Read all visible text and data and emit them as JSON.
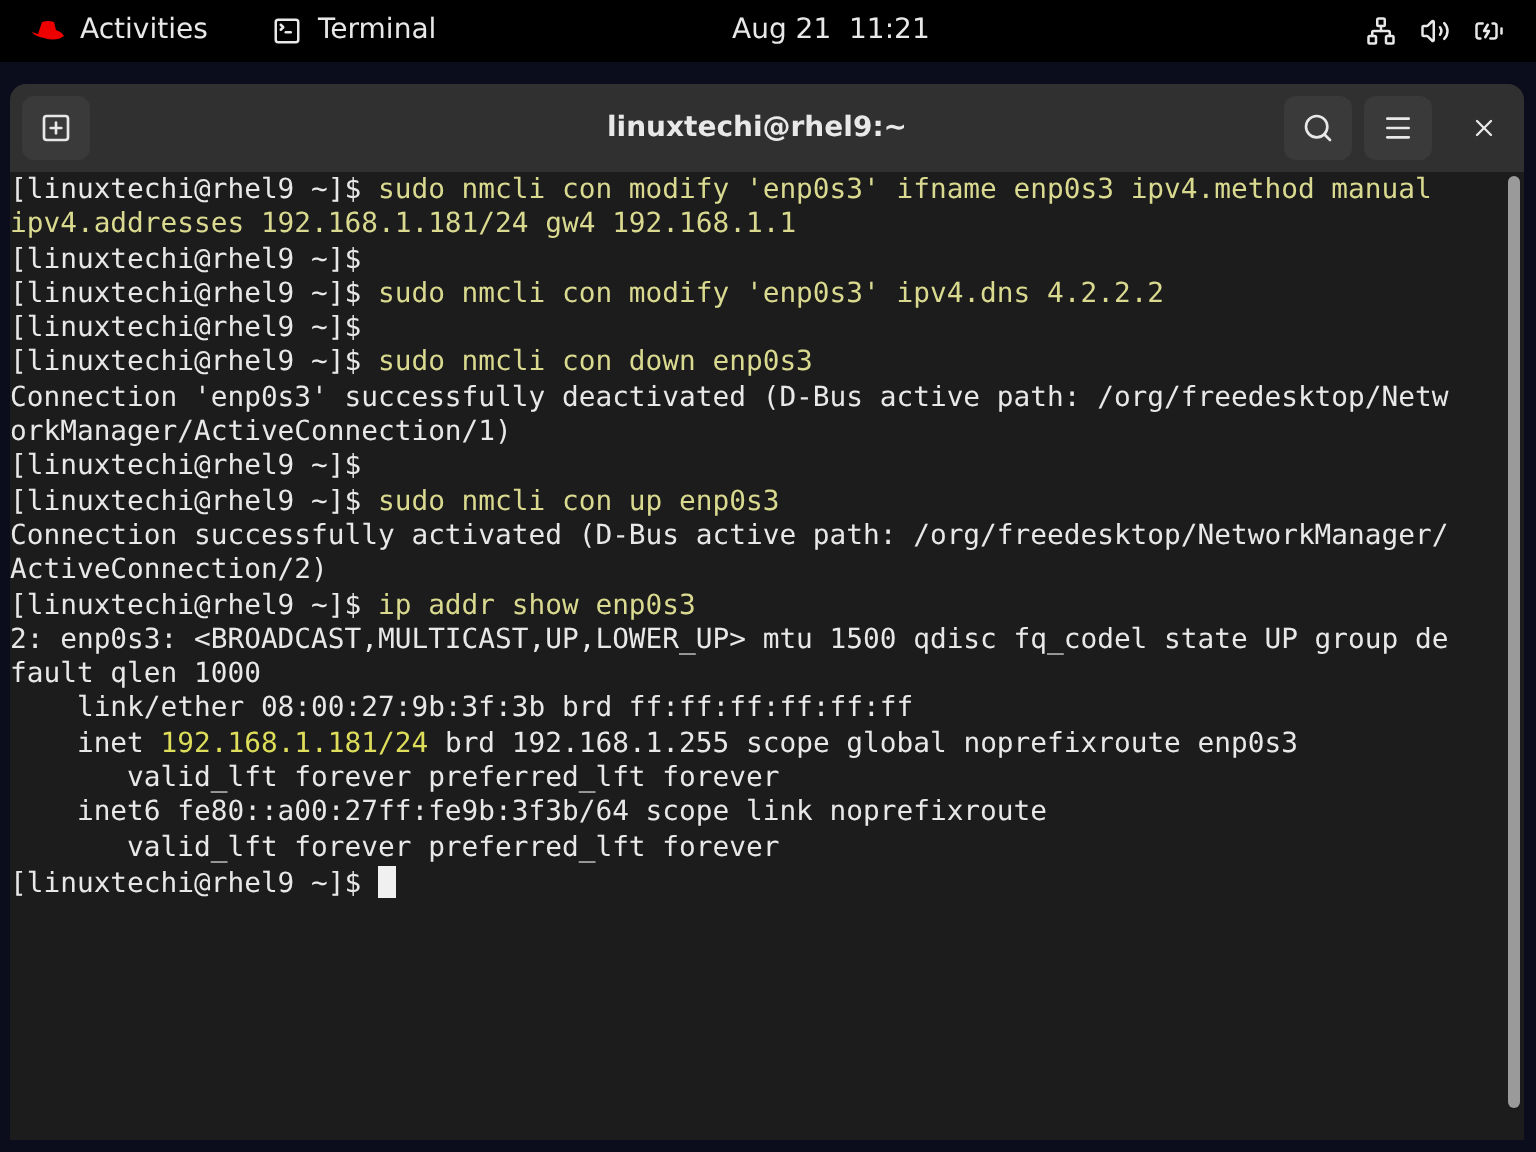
{
  "top_bar": {
    "activities": "Activities",
    "app": "Terminal",
    "clock": "Aug 21  11:21"
  },
  "window": {
    "title": "linuxtechi@rhel9:~"
  },
  "terminal": {
    "lines": [
      [
        {
          "kind": "prompt",
          "text": "[linuxtechi@rhel9 ~]$ "
        },
        {
          "kind": "command",
          "text": "sudo nmcli con modify 'enp0s3' ifname enp0s3 ipv4.method manual"
        }
      ],
      [
        {
          "kind": "command",
          "text": "ipv4.addresses 192.168.1.181/24 gw4 192.168.1.1"
        }
      ],
      [
        {
          "kind": "prompt",
          "text": "[linuxtechi@rhel9 ~]$"
        }
      ],
      [
        {
          "kind": "prompt",
          "text": "[linuxtechi@rhel9 ~]$ "
        },
        {
          "kind": "command",
          "text": "sudo nmcli con modify 'enp0s3' ipv4.dns 4.2.2.2"
        }
      ],
      [
        {
          "kind": "prompt",
          "text": "[linuxtechi@rhel9 ~]$"
        }
      ],
      [
        {
          "kind": "prompt",
          "text": "[linuxtechi@rhel9 ~]$ "
        },
        {
          "kind": "command",
          "text": "sudo nmcli con down enp0s3"
        }
      ],
      [
        {
          "kind": "output",
          "text": "Connection 'enp0s3' successfully deactivated (D-Bus active path: /org/freedesktop/Netw"
        }
      ],
      [
        {
          "kind": "output",
          "text": "orkManager/ActiveConnection/1)"
        }
      ],
      [
        {
          "kind": "prompt",
          "text": "[linuxtechi@rhel9 ~]$"
        }
      ],
      [
        {
          "kind": "prompt",
          "text": "[linuxtechi@rhel9 ~]$ "
        },
        {
          "kind": "command",
          "text": "sudo nmcli con up enp0s3"
        }
      ],
      [
        {
          "kind": "output",
          "text": "Connection successfully activated (D-Bus active path: /org/freedesktop/NetworkManager/"
        }
      ],
      [
        {
          "kind": "output",
          "text": "ActiveConnection/2)"
        }
      ],
      [
        {
          "kind": "prompt",
          "text": "[linuxtechi@rhel9 ~]$ "
        },
        {
          "kind": "command",
          "text": "ip addr show enp0s3"
        }
      ],
      [
        {
          "kind": "output",
          "text": "2: enp0s3: <BROADCAST,MULTICAST,UP,LOWER_UP> mtu 1500 qdisc fq_codel state UP group de"
        }
      ],
      [
        {
          "kind": "output",
          "text": "fault qlen 1000"
        }
      ],
      [
        {
          "kind": "output",
          "text": "    link/ether 08:00:27:9b:3f:3b brd ff:ff:ff:ff:ff:ff"
        }
      ],
      [
        {
          "kind": "output",
          "text": "    inet "
        },
        {
          "kind": "highlight",
          "text": "192.168.1.181/24"
        },
        {
          "kind": "output",
          "text": " brd 192.168.1.255 scope global noprefixroute enp0s3"
        }
      ],
      [
        {
          "kind": "output",
          "text": "       valid_lft forever preferred_lft forever"
        }
      ],
      [
        {
          "kind": "output",
          "text": "    inet6 fe80::a00:27ff:fe9b:3f3b/64 scope link noprefixroute"
        }
      ],
      [
        {
          "kind": "output",
          "text": "       valid_lft forever preferred_lft forever"
        }
      ],
      [
        {
          "kind": "prompt",
          "text": "[linuxtechi@rhel9 ~]$ "
        },
        {
          "kind": "cursor"
        }
      ]
    ]
  }
}
